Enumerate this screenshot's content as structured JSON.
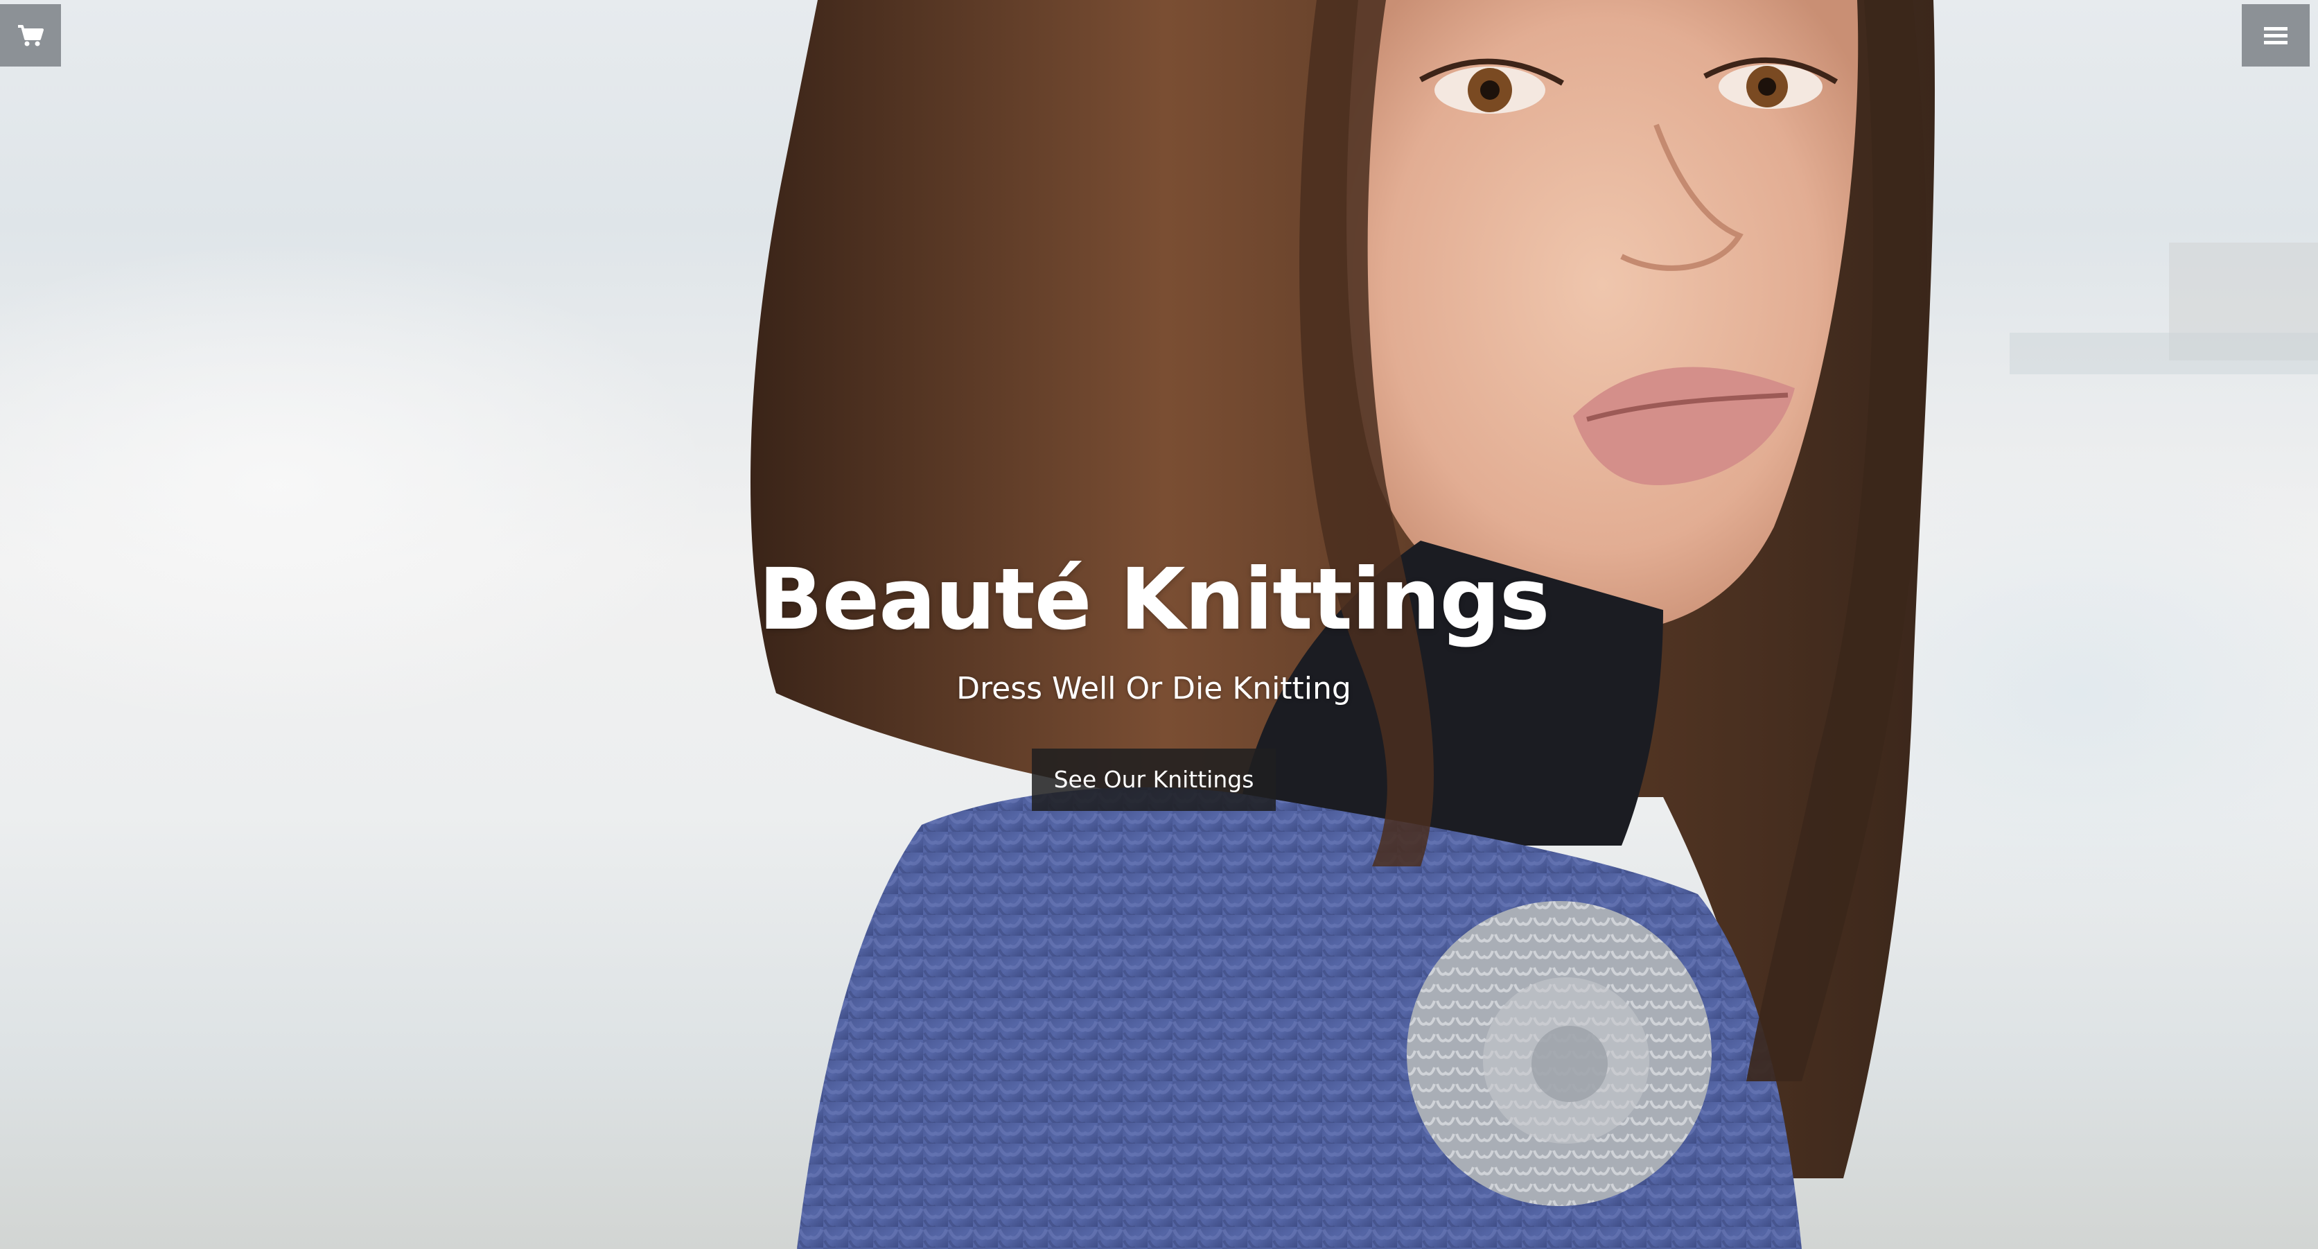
{
  "hero": {
    "title": "Beauté Knittings",
    "subtitle": "Dress Well Or Die Knitting",
    "cta_label": "See Our Knittings"
  },
  "toolbar": {
    "cart_icon": "cart-icon",
    "menu_icon": "hamburger-menu-icon"
  },
  "colors": {
    "button_bg": "#1e1e20",
    "corner_button_bg": "#6e7378",
    "text": "#ffffff",
    "sweater": "#4f5f9c",
    "hair": "#5a3a26"
  }
}
